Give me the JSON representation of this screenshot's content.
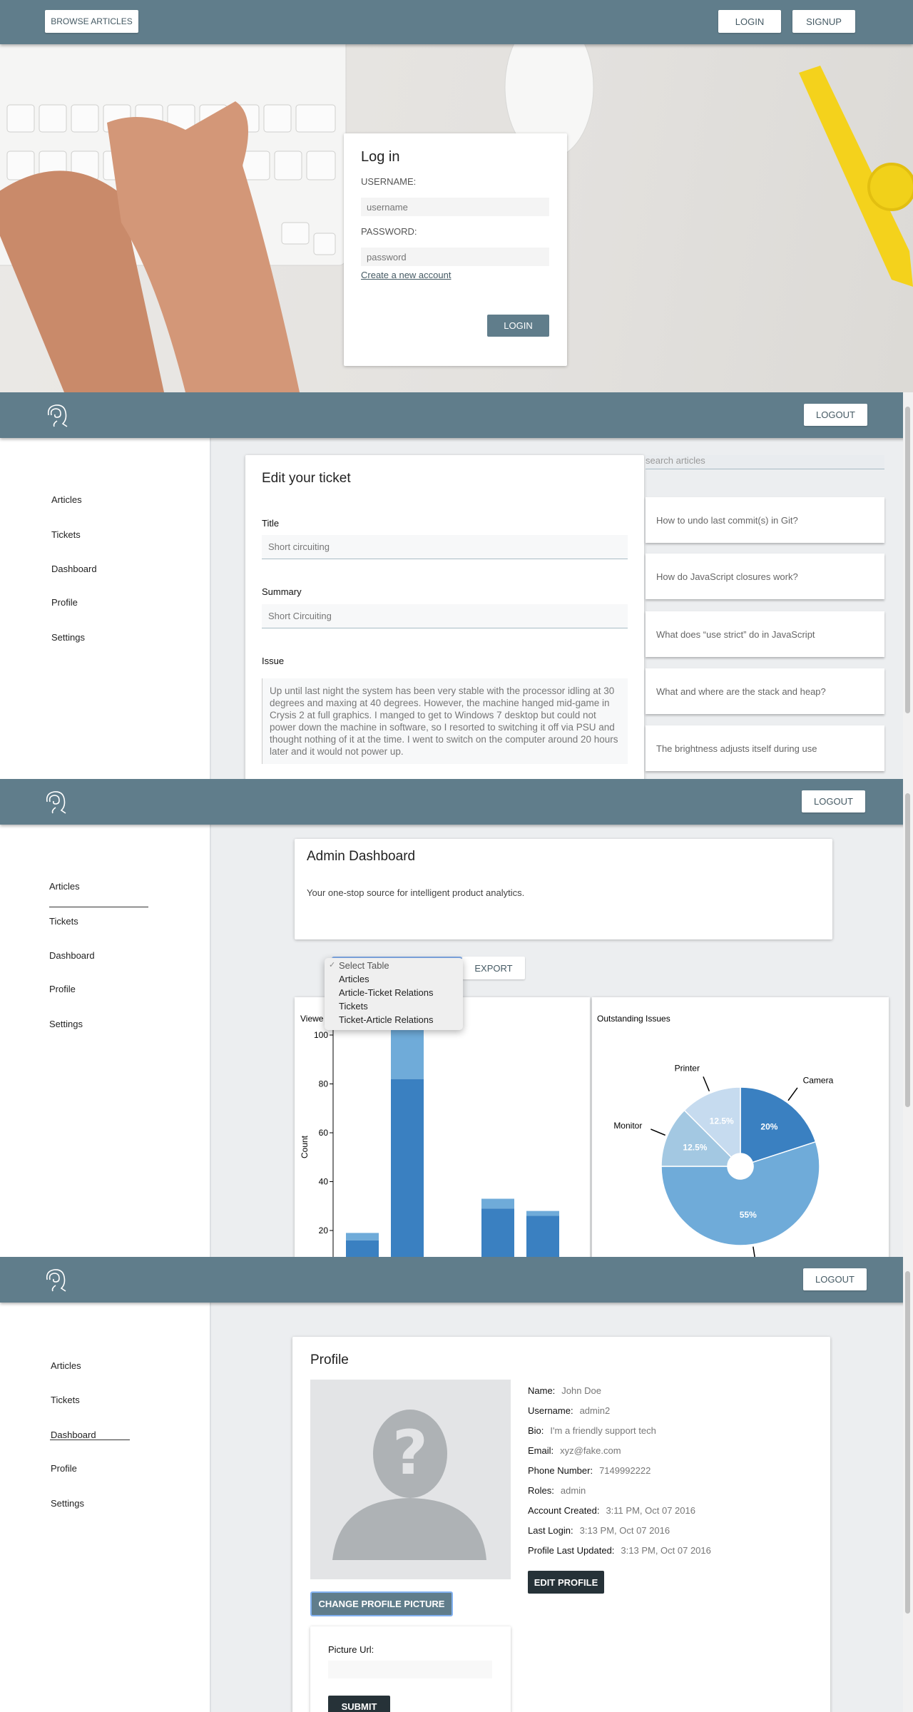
{
  "landing": {
    "browse_label": "BROWSE ARTICLES",
    "login_label": "LOGIN",
    "signup_label": "SIGNUP",
    "login_card": {
      "title": "Log in",
      "username_label": "USERNAME:",
      "username_placeholder": "username",
      "password_label": "PASSWORD:",
      "password_placeholder": "password",
      "create_account_link": "Create a new account",
      "submit_label": "LOGIN"
    }
  },
  "header": {
    "logout_label": "LOGOUT"
  },
  "sidebar": {
    "items": [
      {
        "label": "Articles"
      },
      {
        "label": "Tickets"
      },
      {
        "label": "Dashboard"
      },
      {
        "label": "Profile"
      },
      {
        "label": "Settings"
      }
    ]
  },
  "ticket": {
    "title": "Edit your ticket",
    "title_label": "Title",
    "title_value": "Short circuiting",
    "summary_label": "Summary",
    "summary_value": "Short Circuiting",
    "issue_label": "Issue",
    "issue_value": "Up until last night the system has been very stable with the processor idling at 30 degrees and maxing at 40 degrees. However, the machine hanged mid-game in Crysis 2 at full graphics. I manged to get to Windows 7 desktop but could not power down the machine in software, so I resorted to switching it off via PSU and thought nothing of it at the time. I went to switch on the computer around 20 hours later and it would not power up."
  },
  "articles": {
    "search_placeholder": "search articles",
    "items": [
      {
        "title": "How to undo last commit(s) in Git?"
      },
      {
        "title": "How do JavaScript closures work?"
      },
      {
        "title": "What does “use strict” do in JavaScript"
      },
      {
        "title": "What and where are the stack and heap?"
      },
      {
        "title": "The brightness adjusts itself during use"
      }
    ]
  },
  "dashboard": {
    "title": "Admin Dashboard",
    "subtitle": "Your one-stop source for intelligent product analytics.",
    "export_label": "EXPORT",
    "select": {
      "selected": "Select Table",
      "options": [
        "Select Table",
        "Articles",
        "Article-Ticket Relations",
        "Tickets",
        "Ticket-Article Relations"
      ]
    }
  },
  "chart_data": [
    {
      "type": "bar",
      "title": "Viewe",
      "ylabel": "Count",
      "ylim": [
        0,
        100
      ],
      "yticks": [
        20,
        40,
        60,
        80,
        100
      ],
      "stacked": true,
      "grid": false,
      "series": [
        {
          "values": [
            16,
            82,
            0,
            29,
            26
          ],
          "color": "#3a80c1"
        },
        {
          "values": [
            3,
            25,
            0,
            4,
            2
          ],
          "color": "#6fabd9"
        }
      ]
    },
    {
      "type": "pie",
      "title": "Outstanding Issues",
      "slices": [
        {
          "label": "Camera",
          "value": 20,
          "text": "20%",
          "color": "#3a80c1"
        },
        {
          "label": "",
          "value": 55,
          "text": "55%",
          "color": "#6fabd9"
        },
        {
          "label": "Monitor",
          "value": 12.5,
          "text": "12.5%",
          "color": "#a3c8e2"
        },
        {
          "label": "Printer",
          "value": 12.5,
          "text": "12.5%",
          "color": "#c6dbef"
        }
      ]
    }
  ],
  "profile": {
    "title": "Profile",
    "change_picture_label": "CHANGE PROFILE PICTURE",
    "edit_label": "EDIT PROFILE",
    "picture_url_label": "Picture Url:",
    "submit_label": "SUBMIT",
    "fields": [
      {
        "label": "Name:",
        "value": "John Doe"
      },
      {
        "label": "Username:",
        "value": "admin2"
      },
      {
        "label": "Bio:",
        "value": "I'm a friendly support tech"
      },
      {
        "label": "Email:",
        "value": "xyz@fake.com"
      },
      {
        "label": "Phone Number:",
        "value": "7149992222"
      },
      {
        "label": "Roles:",
        "value": "admin"
      },
      {
        "label": "Account Created:",
        "value": "3:11 PM, Oct 07 2016"
      },
      {
        "label": "Last Login:",
        "value": "3:13 PM, Oct 07 2016"
      },
      {
        "label": "Profile Last Updated:",
        "value": "3:13 PM, Oct 07 2016"
      }
    ]
  },
  "colors": {
    "header": "#607d8b",
    "primary_dark": "#263238",
    "bar_dark": "#3a80c1",
    "bar_light": "#6fabd9"
  }
}
